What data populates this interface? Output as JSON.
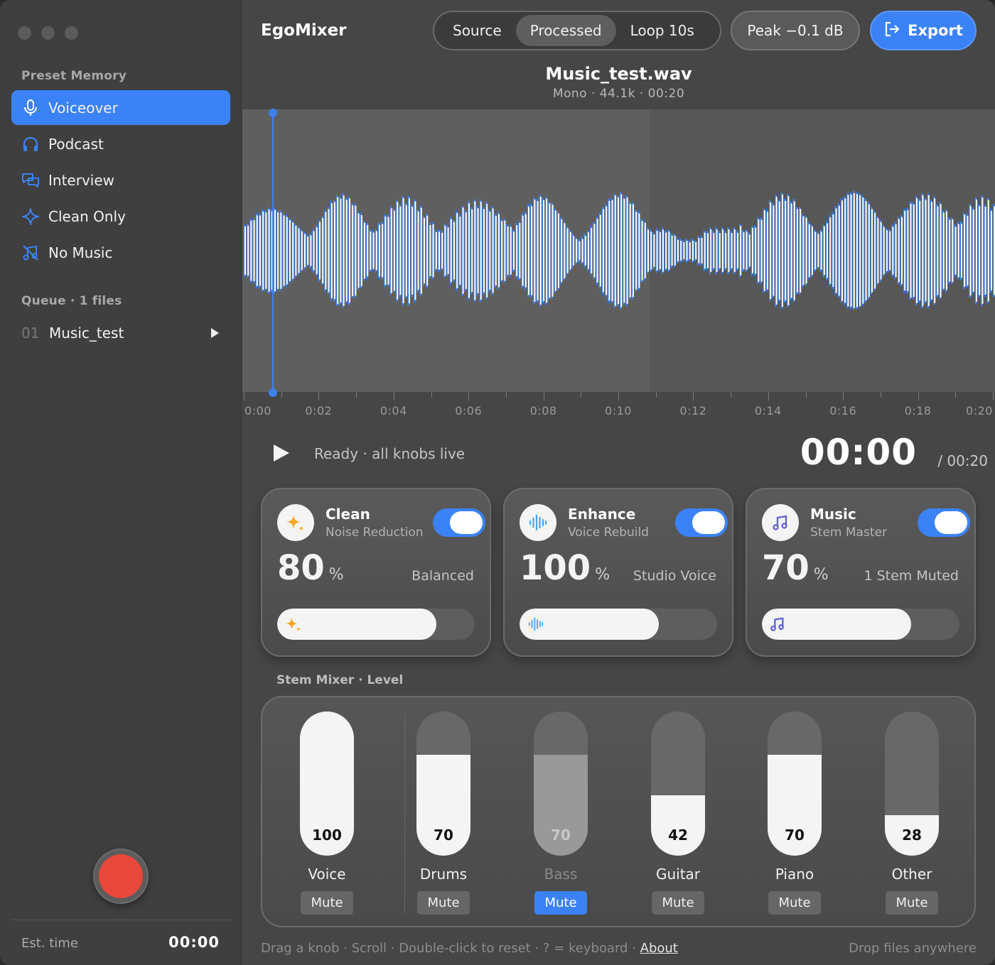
{
  "sidebar": {
    "preset_label": "Preset Memory",
    "presets": [
      {
        "label": "Voiceover",
        "icon": "microphone-icon",
        "active": true
      },
      {
        "label": "Podcast",
        "icon": "headphones-icon",
        "active": false
      },
      {
        "label": "Interview",
        "icon": "chat-bubbles-icon",
        "active": false
      },
      {
        "label": "Clean Only",
        "icon": "sparkle-icon",
        "active": false
      },
      {
        "label": "No Music",
        "icon": "music-off-icon",
        "active": false
      }
    ],
    "queue_label": "Queue · 1 files",
    "queue": [
      {
        "num": "01",
        "name": "Music_test"
      }
    ],
    "est_label": "Est. time",
    "est_value": "00:00"
  },
  "header": {
    "app_title": "EgoMixer",
    "modes": [
      {
        "label": "Source",
        "active": false
      },
      {
        "label": "Processed",
        "active": true
      },
      {
        "label": "Loop 10s",
        "active": false
      }
    ],
    "peak": "Peak −0.1 dB",
    "export_label": "Export"
  },
  "file": {
    "name": "Music_test.wav",
    "meta": "Mono · 44.1k · 00:20"
  },
  "timeline": {
    "labels": [
      "0:00",
      "0:02",
      "0:04",
      "0:06",
      "0:08",
      "0:10",
      "0:12",
      "0:14",
      "0:16",
      "0:18",
      "0:20"
    ]
  },
  "transport": {
    "status": "Ready · all knobs live",
    "current": "00:00",
    "total": "/ 00:20"
  },
  "cards": [
    {
      "title": "Clean",
      "subtitle": "Noise Reduction",
      "value": "80",
      "unit": "%",
      "desc": "Balanced",
      "level": 0.8,
      "icon": "sparkle-icon",
      "icon_color": "#f5a623",
      "enabled": true
    },
    {
      "title": "Enhance",
      "subtitle": "Voice Rebuild",
      "value": "100",
      "unit": "%",
      "desc": "Studio Voice",
      "level": 0.7,
      "icon": "waveform-icon",
      "icon_color": "#4aa3e6",
      "enabled": true
    },
    {
      "title": "Music",
      "subtitle": "Stem Master",
      "value": "70",
      "unit": "%",
      "desc": "1 Stem Muted",
      "level": 0.75,
      "icon": "music-note-icon",
      "icon_color": "#5b5bd6",
      "enabled": true
    }
  ],
  "stems": {
    "label": "Stem Mixer · Level",
    "mute_label": "Mute",
    "items": [
      {
        "name": "Voice",
        "value": "100",
        "level": 1.0,
        "muted": false
      },
      {
        "name": "Drums",
        "value": "70",
        "level": 0.7,
        "muted": false
      },
      {
        "name": "Bass",
        "value": "70",
        "level": 0.7,
        "muted": true
      },
      {
        "name": "Guitar",
        "value": "42",
        "level": 0.42,
        "muted": false
      },
      {
        "name": "Piano",
        "value": "70",
        "level": 0.7,
        "muted": false
      },
      {
        "name": "Other",
        "value": "28",
        "level": 0.28,
        "muted": false
      }
    ]
  },
  "footer": {
    "hint": "Drag a knob · Scroll · Double-click to reset · ? = keyboard · ",
    "about": "About",
    "right": "Drop files anywhere"
  },
  "colors": {
    "accent": "#3b82f6",
    "record": "#e8483b",
    "wave_white": "#ffffff",
    "wave_blue": "#3b82f6"
  }
}
